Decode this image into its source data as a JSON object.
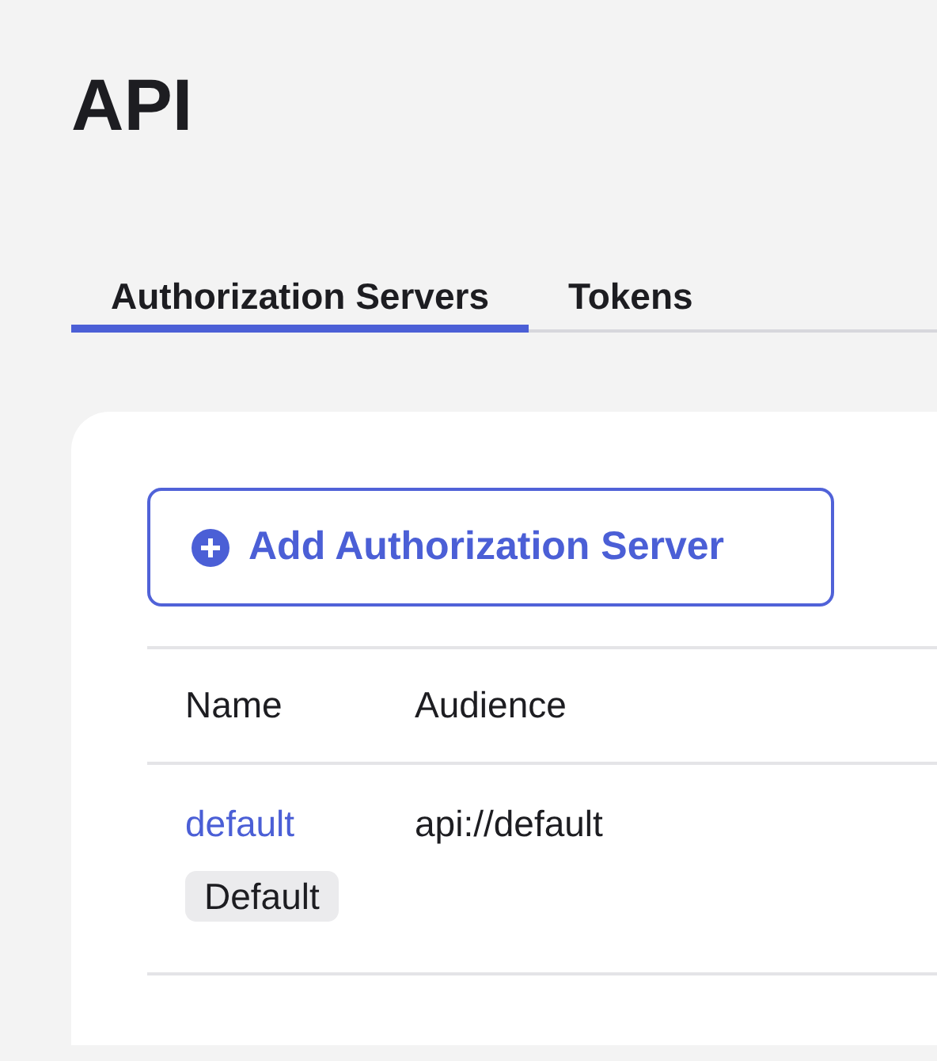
{
  "page_title": "API",
  "tabs": [
    {
      "label": "Authorization Servers",
      "selected": true
    },
    {
      "label": "Tokens",
      "selected": false
    }
  ],
  "add_button": {
    "label": "Add Authorization Server"
  },
  "table": {
    "columns": [
      "Name",
      "Audience"
    ],
    "rows": [
      {
        "name": "default",
        "badge": "Default",
        "audience": "api://default"
      }
    ]
  }
}
